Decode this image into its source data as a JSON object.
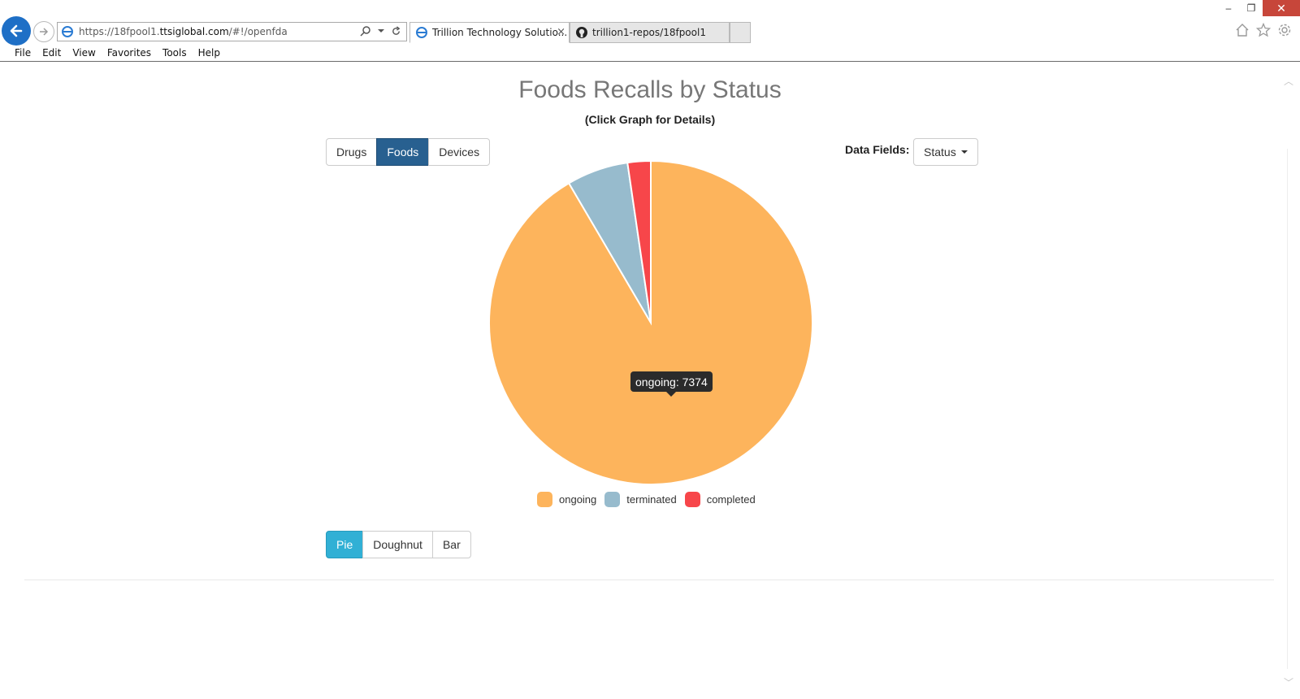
{
  "browser": {
    "url_prefix": "https://18fpool1.",
    "url_domain": "ttsiglobal.com",
    "url_suffix": "/#!/openfda",
    "tabs": [
      {
        "label": "Trillion Technology Solutio..."
      },
      {
        "label": "trillion1-repos/18fpool1"
      }
    ],
    "menu": [
      "File",
      "Edit",
      "View",
      "Favorites",
      "Tools",
      "Help"
    ]
  },
  "page": {
    "title": "Foods Recalls by Status",
    "subtitle": "(Click Graph for Details)",
    "dataset_buttons": [
      "Drugs",
      "Foods",
      "Devices"
    ],
    "active_dataset": "Foods",
    "data_fields_label": "Data Fields:",
    "data_field_selected": "Status",
    "chart_type_buttons": [
      "Pie",
      "Doughnut",
      "Bar"
    ],
    "active_chart_type": "Pie",
    "tooltip": "ongoing: 7374"
  },
  "chart_data": {
    "type": "pie",
    "title": "Foods Recalls by Status",
    "categories": [
      "ongoing",
      "terminated",
      "completed"
    ],
    "values": [
      7374,
      495,
      186
    ],
    "colors": [
      "#FDB45C",
      "#97BBCD",
      "#F7464A"
    ],
    "legend_position": "bottom"
  }
}
